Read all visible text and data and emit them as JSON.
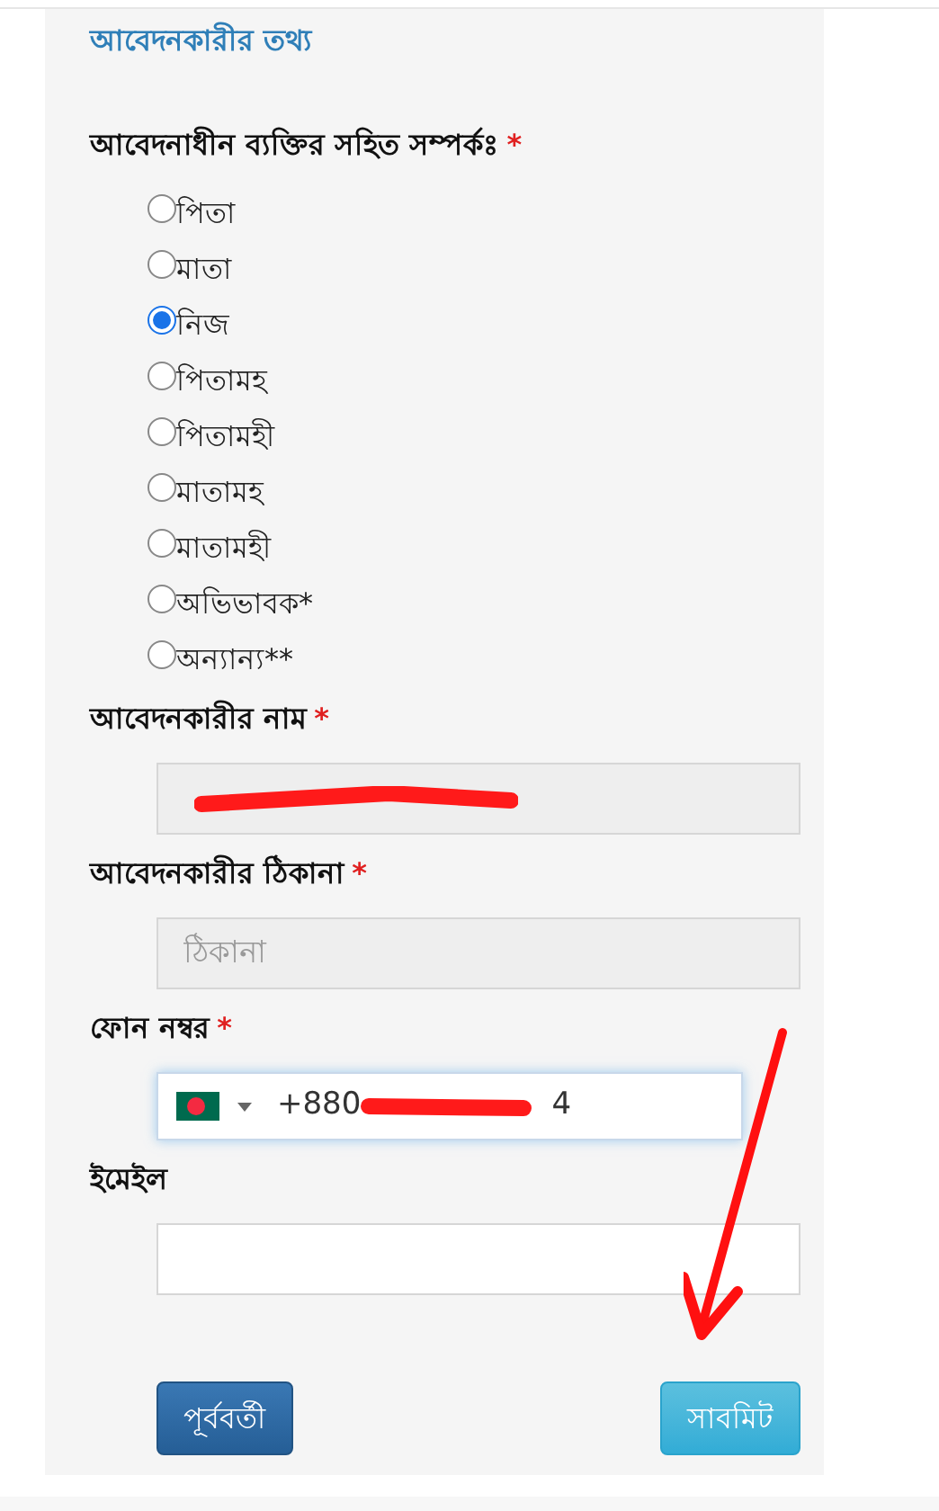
{
  "section_title": "আবেদনকারীর তথ্য",
  "relation": {
    "label": "আবেদনাধীন ব্যক্তির সহিত সম্পর্কঃ",
    "required_mark": "*",
    "options": [
      {
        "label": "পিতা",
        "selected": false
      },
      {
        "label": "মাতা",
        "selected": false
      },
      {
        "label": "নিজ",
        "selected": true
      },
      {
        "label": "পিতামহ",
        "selected": false
      },
      {
        "label": "পিতামহী",
        "selected": false
      },
      {
        "label": "মাতামহ",
        "selected": false
      },
      {
        "label": "মাতামহী",
        "selected": false
      },
      {
        "label": "অভিভাবক*",
        "selected": false
      },
      {
        "label": "অন্যান্য**",
        "selected": false
      }
    ]
  },
  "fields": [
    {
      "kind": "redacted",
      "label": "আবেদনকারীর নাম",
      "required_mark": "*",
      "disabled": true
    },
    {
      "kind": "text",
      "label": "আবেদনকারীর ঠিকানা",
      "required_mark": "*",
      "placeholder": "ঠিকানা",
      "disabled": true
    },
    {
      "kind": "phone",
      "label": "ফোন নম্বর",
      "required_mark": "*",
      "value": "+880",
      "value_end": "4",
      "disabled": false
    },
    {
      "kind": "text",
      "label": "ইমেইল",
      "disabled": false
    }
  ],
  "buttons": [
    {
      "label": "পূর্ববর্তী",
      "kind": "previous"
    },
    {
      "label": "সাবমিট",
      "kind": "submit"
    }
  ]
}
